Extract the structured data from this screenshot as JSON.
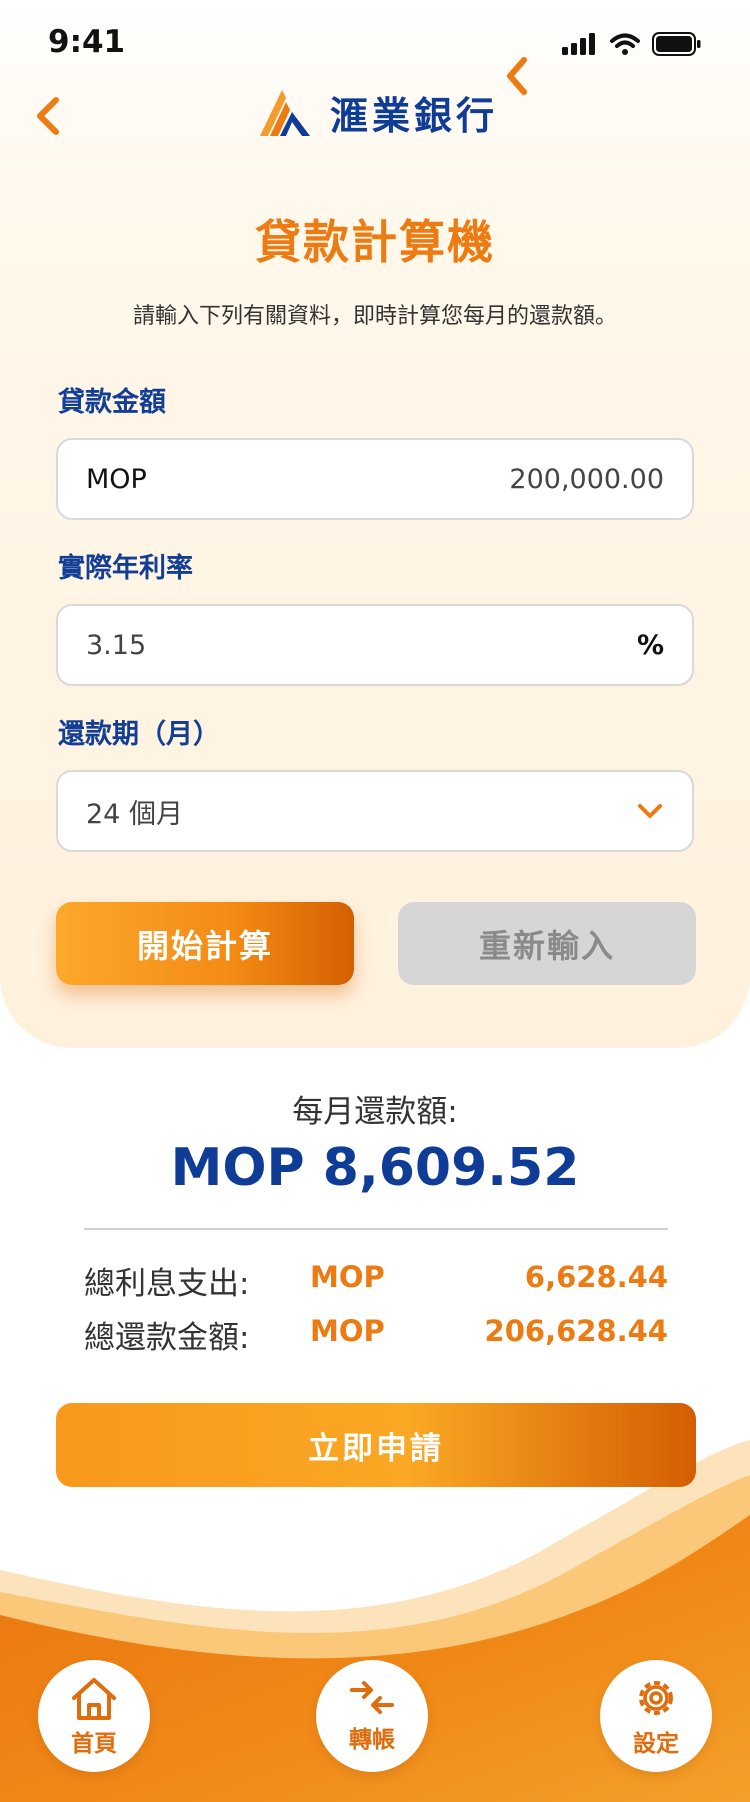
{
  "status_bar": {
    "time": "9:41"
  },
  "header": {
    "bank_name": "滙業銀行"
  },
  "calculator": {
    "title": "貸款計算機",
    "subtitle": "請輸入下列有關資料，即時計算您每月的還款額。",
    "loan_amount": {
      "label": "貸款金額",
      "currency": "MOP",
      "value": "200,000.00"
    },
    "interest_rate": {
      "label": "實際年利率",
      "value": "3.15",
      "suffix": "%"
    },
    "term": {
      "label": "還款期（月）",
      "selected": "24 個月"
    },
    "calculate_label": "開始計算",
    "reset_label": "重新輸入"
  },
  "result": {
    "monthly_label": "每月還款額:",
    "monthly_value": "MOP 8,609.52",
    "interest": {
      "label": "總利息支出:",
      "currency": "MOP",
      "amount": "6,628.44"
    },
    "total": {
      "label": "總還款金額:",
      "currency": "MOP",
      "amount": "206,628.44"
    }
  },
  "apply_label": "立即申請",
  "bottom_nav": [
    {
      "label": "首頁",
      "icon": "home-icon"
    },
    {
      "label": "轉帳",
      "icon": "transfer-icon"
    },
    {
      "label": "設定",
      "icon": "gear-icon"
    }
  ],
  "colors": {
    "brand_orange": "#ee7a12",
    "brand_blue": "#0f3c96"
  }
}
